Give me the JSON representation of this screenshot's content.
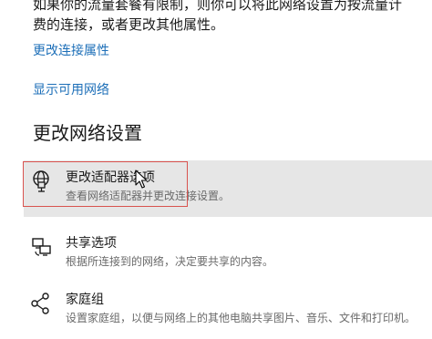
{
  "header": {
    "description_lines": [
      "如果你的流量套餐有限制，则你可以将此网络设置为按流量计",
      "费的连接，或者更改其他属性。"
    ]
  },
  "links": {
    "change_connection_properties": "更改连接属性",
    "show_available_networks": "显示可用网络"
  },
  "section": {
    "title": "更改网络设置"
  },
  "options": [
    {
      "title": "更改适配器选项",
      "description": "查看网络适配器并更改连接设置。",
      "icon": "network-adapter-icon"
    },
    {
      "title": "共享选项",
      "description": "根据所连接到的网络，决定要共享的内容。",
      "icon": "sharing-icon"
    },
    {
      "title": "家庭组",
      "description": "设置家庭组，以便与网络上的其他电脑共享图片、音乐、文件和打印机。",
      "icon": "homegroup-icon"
    }
  ],
  "colors": {
    "link": "#1d6fb8",
    "hover_background": "#e6e6e6",
    "annotation_box": "#d9534f"
  }
}
